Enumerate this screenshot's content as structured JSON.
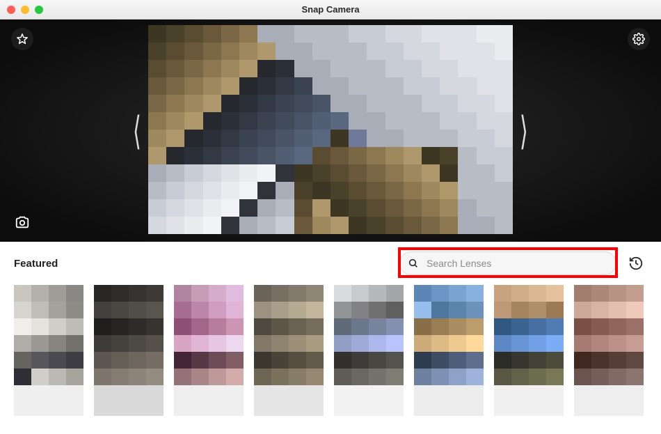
{
  "title": "Snap Camera",
  "panel": {
    "section_label": "Featured",
    "search_placeholder": "Search Lenses"
  },
  "colors": {
    "highlight": "#ff0000"
  },
  "preview_palette": [
    "#24262c",
    "#2a2d33",
    "#2f323a",
    "#343742",
    "#3a3c4b",
    "#3f4252",
    "#454a5b",
    "#4a5064",
    "#51566d",
    "#585f78",
    "#5d657f",
    "#636b87",
    "#6a7292",
    "#71799a",
    "#787fa3",
    "#8088ad",
    "#a9adb8",
    "#b8bcc5",
    "#c8ccd5",
    "#d5d8df",
    "#e0e2e8",
    "#eaecf0",
    "#f2f3f6",
    "#31333b",
    "#3c3622",
    "#4a412a",
    "#594c31",
    "#69593a",
    "#7a6745",
    "#8c7751",
    "#9e885e",
    "#af996c",
    "#25282d",
    "#2b3038",
    "#323844",
    "#3b4250",
    "#424b5b",
    "#495567",
    "#515e73",
    "#5a687f"
  ],
  "lenses": [
    {
      "palette": [
        "#c9c6bf",
        "#b3b0a9",
        "#9f9d98",
        "#8a8884",
        "#d6d4ce",
        "#bfbdb6",
        "#a4a29c",
        "#8e8c87",
        "#f0efec",
        "#e5e3de",
        "#d0cec8",
        "#bebcb6",
        "#afada7",
        "#9b9993",
        "#878580",
        "#73716c",
        "#65645f",
        "#58575c",
        "#4b4a51",
        "#3d3c43",
        "#2f2e36",
        "#cfcec9",
        "#bbb9b3",
        "#a6a39d"
      ],
      "caption_bg": "#efefef"
    },
    {
      "palette": [
        "#272625",
        "#2e2d2b",
        "#353331",
        "#3c3937",
        "#43403d",
        "#4a4642",
        "#514d48",
        "#58544e",
        "#1f1e1c",
        "#262523",
        "#2e2c2a",
        "#363430",
        "#3d3b37",
        "#45423d",
        "#4d4944",
        "#55504a",
        "#5d5751",
        "#655e57",
        "#6d665e",
        "#756d64",
        "#7d756b",
        "#857c72",
        "#8d8378",
        "#958b7f"
      ],
      "caption_bg": "#d9d9d9"
    },
    {
      "palette": [
        "#b184a1",
        "#c69cb6",
        "#d6accc",
        "#e2bcdf",
        "#a56e90",
        "#bb86a8",
        "#cf9ebf",
        "#e1b5d7",
        "#8e4f75",
        "#a36689",
        "#b87d9e",
        "#cd94b3",
        "#d8a5c4",
        "#e0b6d4",
        "#e6c7e2",
        "#ecd8ef",
        "#422636",
        "#573946",
        "#6b4c57",
        "#805f67",
        "#957278",
        "#aa8588",
        "#bf9999",
        "#d3aca9"
      ],
      "caption_bg": "#efefef"
    },
    {
      "palette": [
        "#6a6358",
        "#766f62",
        "#837a6c",
        "#8f8675",
        "#9c927f",
        "#a99e89",
        "#b5aa92",
        "#c2b69c",
        "#4f4a3f",
        "#5c5649",
        "#696152",
        "#766d5c",
        "#827865",
        "#8f846f",
        "#9c9078",
        "#a89b82",
        "#3b372e",
        "#484337",
        "#554e41",
        "#615a4a",
        "#6e6554",
        "#7b715d",
        "#877c67",
        "#948871"
      ],
      "caption_bg": "#e5e5e5"
    },
    {
      "palette": [
        "#d9dbde",
        "#c8cacd",
        "#b6b8ba",
        "#a5a6a8",
        "#939496",
        "#828284",
        "#707071",
        "#5f5f60",
        "#5e6a77",
        "#6b778a",
        "#78849e",
        "#8591b1",
        "#929ec5",
        "#9faad8",
        "#acb7ec",
        "#b9c4ff",
        "#32312e",
        "#3d3c38",
        "#484742",
        "#53524c",
        "#5e5c56",
        "#696760",
        "#74726a",
        "#7f7c74"
      ],
      "caption_bg": "#f2f2f2"
    },
    {
      "palette": [
        "#5b87b6",
        "#6a95c4",
        "#79a3d1",
        "#88b1df",
        "#97bfed",
        "#4d779f",
        "#5c85ad",
        "#6b93bb",
        "#886f48",
        "#997e54",
        "#aa8d60",
        "#bb9c6c",
        "#ccab78",
        "#ddbb84",
        "#eeca90",
        "#ffd99c",
        "#2e3c50",
        "#3e4d64",
        "#4e5e78",
        "#5e6f8c",
        "#6e80a0",
        "#7e91b4",
        "#8ea2c8",
        "#9eb3dc"
      ],
      "caption_bg": "#ededed"
    },
    {
      "palette": [
        "#c7a47f",
        "#d1ae89",
        "#dbb893",
        "#e5c29d",
        "#bd9a75",
        "#a6855e",
        "#b08f68",
        "#9c7b54",
        "#305880",
        "#3b6491",
        "#4670a2",
        "#517cb3",
        "#5c88c4",
        "#6794d5",
        "#72a0e6",
        "#7dacf7",
        "#2b2b28",
        "#36362f",
        "#414135",
        "#4c4c3c",
        "#575743",
        "#62624a",
        "#6d6d50",
        "#787857"
      ],
      "caption_bg": "#f0f0f0"
    },
    {
      "palette": [
        "#a27c6d",
        "#ad8778",
        "#b89283",
        "#c39d8e",
        "#cea899",
        "#d9b3a4",
        "#e4beaf",
        "#efc9ba",
        "#7a4f46",
        "#855a51",
        "#90655c",
        "#9b7067",
        "#a67b72",
        "#b1867d",
        "#bc9188",
        "#c79c93",
        "#3f2821",
        "#4a332c",
        "#553e37",
        "#604942",
        "#6b544d",
        "#765f58",
        "#816a63",
        "#8c756e"
      ],
      "caption_bg": "#eeeeee"
    }
  ]
}
